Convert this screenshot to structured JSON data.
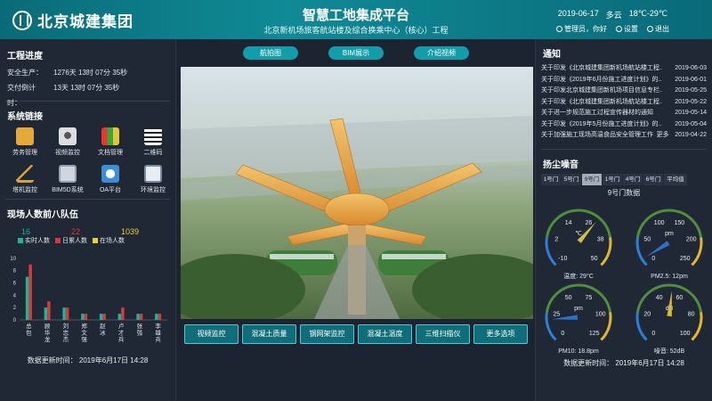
{
  "header": {
    "logo_text": "北京城建集团",
    "title": "智慧工地集成平台",
    "subtitle": "北京新机场旅客航站楼及综合换乘中心（核心）工程",
    "date": "2019-06-17",
    "weather": "多云",
    "temp": "18℃-29℃",
    "greeting": "管理员，你好",
    "settings": "设置",
    "logout": "退出"
  },
  "left": {
    "progress_title": "工程进度",
    "progress": [
      {
        "label": "安全生产：",
        "value": "1276天 13时 07分 35秒"
      },
      {
        "label": "交付倒计时：",
        "value": "13天 13时 07分 35秒"
      }
    ],
    "links_title": "系统链接",
    "links": [
      {
        "label": "劳务管理",
        "icon": "hard-hat-icon"
      },
      {
        "label": "视频监控",
        "icon": "camera-icon"
      },
      {
        "label": "文档管理",
        "icon": "binders-icon"
      },
      {
        "label": "二维码",
        "icon": "qr-code-icon"
      },
      {
        "label": "塔机监控",
        "icon": "crane-icon"
      },
      {
        "label": "BIM5D系统",
        "icon": "bim-icon"
      },
      {
        "label": "OA平台",
        "icon": "oa-icon"
      },
      {
        "label": "环境监控",
        "icon": "environment-icon"
      }
    ],
    "team_title": "现场人数前八队伍",
    "counts": {
      "real": "16",
      "day": "22",
      "onsite": "1039"
    },
    "legend": [
      "实时人数",
      "日累人数",
      "在场人数"
    ],
    "updated": "数据更新时间：  2019年6月17日  14:28"
  },
  "chart_data": {
    "type": "bar",
    "categories": [
      "总包",
      "顾华龙",
      "刘忠杰",
      "郑文强",
      "赵冰",
      "卢才兵",
      "张强",
      "李雄兵"
    ],
    "series": [
      {
        "name": "实时人数",
        "values": [
          7,
          2,
          2,
          1,
          1,
          1,
          1,
          1
        ]
      },
      {
        "name": "日累人数",
        "values": [
          9,
          3,
          2,
          1,
          1,
          2,
          1,
          1
        ]
      }
    ],
    "ylim": [
      0,
      11
    ],
    "yticks": [
      0,
      2,
      4,
      6,
      8,
      10
    ],
    "colors": {
      "real": "#1fb39a",
      "day": "#d63a3a",
      "onsite": "#e8d22c"
    }
  },
  "center": {
    "top_buttons": [
      "航拍图",
      "BIM展示",
      "介绍视频"
    ],
    "bottom_buttons": [
      "视频监控",
      "混凝土质量",
      "钢网架监控",
      "混凝土温度",
      "三维扫描仪",
      "更多选项"
    ]
  },
  "right": {
    "notice_title": "通知",
    "notices": [
      {
        "title": "关于印发《北京城建集团新机场航站楼工程...",
        "date": "2019-06-03"
      },
      {
        "title": "关于印发《2019年6月份施工进度计划》的...",
        "date": "2019-06-01"
      },
      {
        "title": "关于印发北京城建集团新机场项目信息专栏...",
        "date": "2019-05-25"
      },
      {
        "title": "关于印发《北京城建集团新机场航站楼工程...",
        "date": "2019-05-22"
      },
      {
        "title": "关于进一步规范施工过程宣传器材的通知",
        "date": "2019-05-14"
      },
      {
        "title": "关于印发《2019年5月份施工进度计划》的...",
        "date": "2019-05-04"
      },
      {
        "title": "关于加强施工现场高温食品安全管理工作的...",
        "date": "2019-04-22"
      }
    ],
    "more": "更多",
    "dust_title": "扬尘噪音",
    "gates": [
      "1号门",
      "5号门",
      "9号门",
      "1号门",
      "4号门",
      "6号门",
      "平均值"
    ],
    "active_gate": 2,
    "gate_data_title": "9号门数据",
    "gauges": [
      {
        "unit": "℃",
        "ticks": [
          "-10",
          "2",
          "14",
          "26",
          "38",
          "50"
        ],
        "min": -10,
        "max": 50,
        "value": 29,
        "label": "温度: 29°C"
      },
      {
        "unit": "pm",
        "ticks": [
          "0",
          "50",
          "100",
          "150",
          "200",
          "250"
        ],
        "min": 0,
        "max": 250,
        "value": 12,
        "label": "PM2.5: 12pm"
      },
      {
        "unit": "pm",
        "ticks": [
          "0",
          "25",
          "50",
          "75",
          "100",
          "125"
        ],
        "min": 0,
        "max": 125,
        "value": 18.8,
        "label": "PM10: 18.8pm"
      },
      {
        "unit": "dB",
        "ticks": [
          "0",
          "20",
          "40",
          "60",
          "80",
          "100"
        ],
        "min": 0,
        "max": 100,
        "value": 52,
        "label": "噪音: 52dB"
      }
    ],
    "updated": "数据更新时间：  2019年6月17日  14:28"
  }
}
